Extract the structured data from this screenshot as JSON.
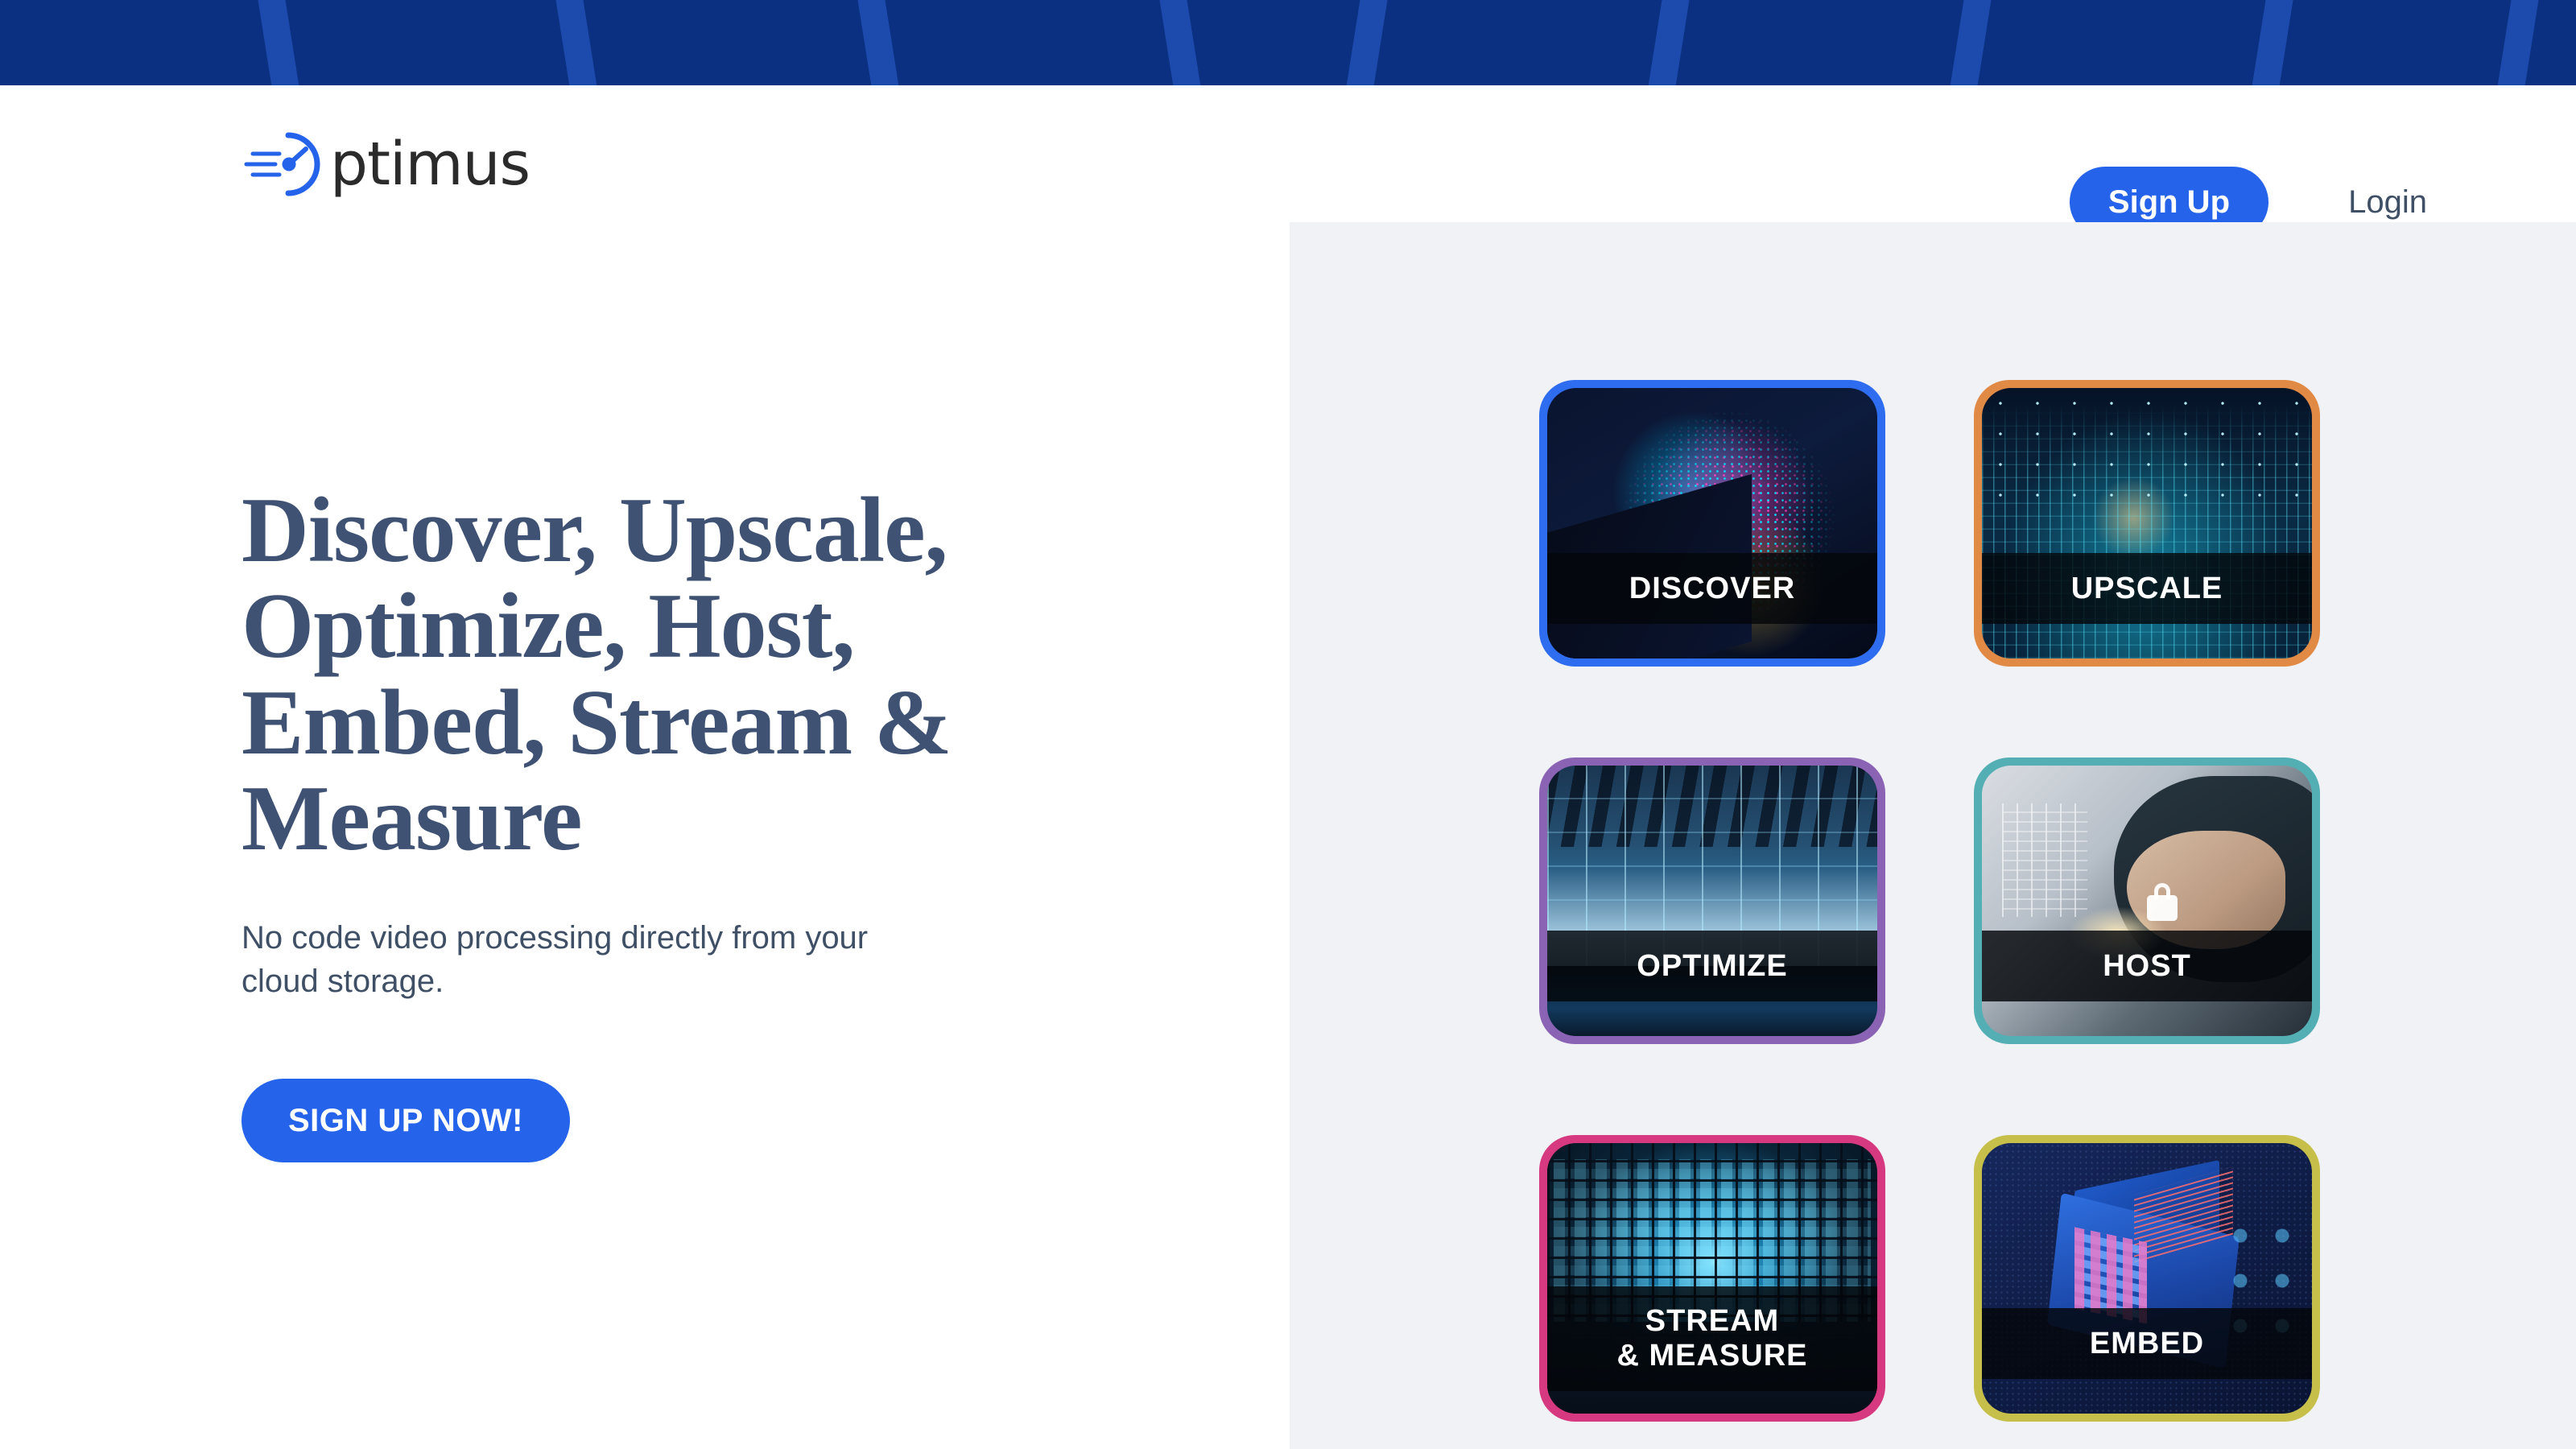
{
  "brand": {
    "logo_icon": "speedometer-icon",
    "wordmark": "ptimus",
    "accent_blue": "#2563eb",
    "banner_navy": "#0c3081",
    "banner_stripe": "#1c4bad",
    "heading_color": "#3f5273",
    "panel_bg": "#f1f2f6"
  },
  "header": {
    "signup_label": "Sign Up",
    "login_label": "Login"
  },
  "hero": {
    "title": "Discover, Upscale, Optimize, Host, Embed, Stream & Measure",
    "subtitle": "No code video processing directly from your cloud storage.",
    "cta_label": "SIGN UP NOW!"
  },
  "tiles": [
    {
      "label": "DISCOVER",
      "border_color": "#2f6df0",
      "art": "art-discover",
      "two_line": false
    },
    {
      "label": "UPSCALE",
      "border_color": "#e08a45",
      "art": "art-upscale",
      "two_line": false
    },
    {
      "label": "OPTIMIZE",
      "border_color": "#8b63b5",
      "art": "art-optimize",
      "two_line": false
    },
    {
      "label": "HOST",
      "border_color": "#54afb4",
      "art": "art-host",
      "two_line": false
    },
    {
      "label": "STREAM & MEASURE",
      "border_color": "#d6397f",
      "art": "art-stream",
      "two_line": true
    },
    {
      "label": "EMBED",
      "border_color": "#c6bf4a",
      "art": "art-embed",
      "two_line": false
    }
  ]
}
